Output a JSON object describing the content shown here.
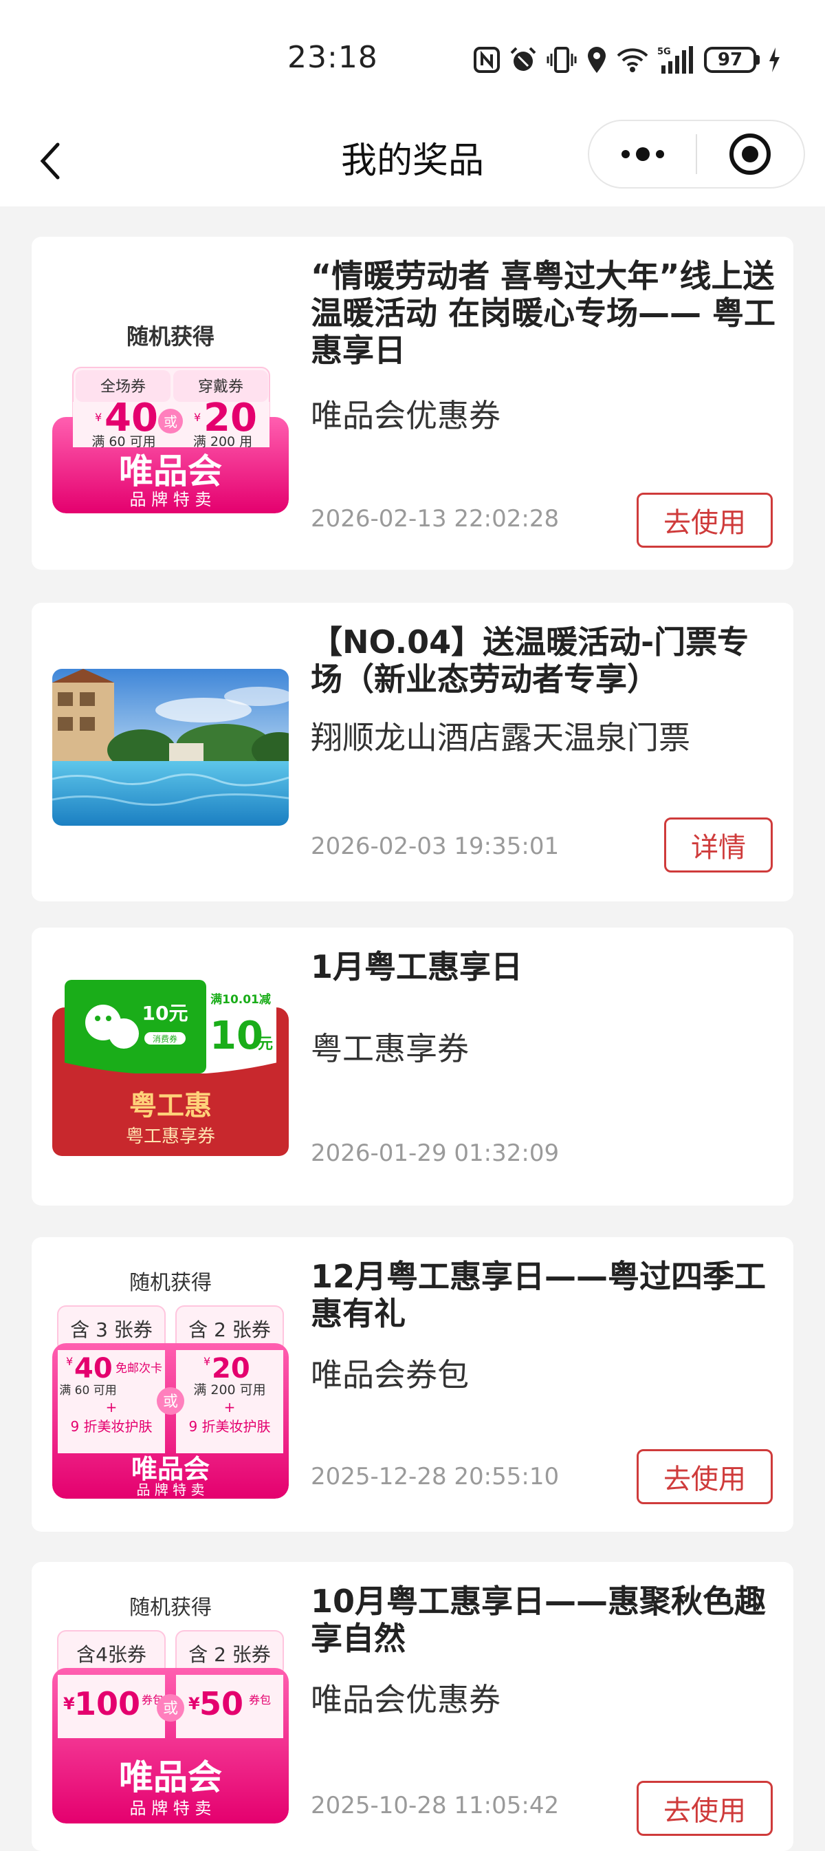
{
  "status_bar": {
    "time": "23:18",
    "battery": "97",
    "network": "5G",
    "icons": [
      "nfc-icon",
      "alarm-icon",
      "vibrate-icon",
      "location-icon",
      "wifi-icon",
      "signal-icon",
      "battery-icon",
      "charging-icon"
    ]
  },
  "nav": {
    "title": "我的奖品",
    "back_icon": "chevron-left-icon",
    "more_icon": "more-dots-icon",
    "close_icon": "target-circle-icon"
  },
  "colors": {
    "accent_red": "#cf3b3b",
    "vip_pink": "#f0268d",
    "wechat_green": "#1aad19",
    "bag_red": "#c8282d"
  },
  "prizes": [
    {
      "title": "“情暖劳动者 喜粤过大年”线上送温暖活动 在岗暖心专场—— 粤工惠享日",
      "subtitle": "唯品会优惠券",
      "time": "2026-02-13 22:02:28",
      "action": "去使用",
      "thumb": {
        "header": "随机获得",
        "tabs": [
          "全场券",
          "穿戴券"
        ],
        "amount_left": "40",
        "cond_left": "满 60 可用",
        "amount_right": "20",
        "cond_right": "满 200 用",
        "or": "或",
        "currency": "¥",
        "brand": "唯品会",
        "brand_sub": "品 牌 特 卖"
      }
    },
    {
      "title": "【NO.04】送温暖活动-门票专场（新业态劳动者专享）",
      "subtitle": "翔顺龙山酒店露天温泉门票",
      "time": "2026-02-03 19:35:01",
      "action": "详情"
    },
    {
      "title": "1月粤工惠享日",
      "subtitle": "粤工惠享券",
      "time": "2026-01-29 01:32:09",
      "thumb": {
        "left_amount": "10元",
        "left_tag": "消费券",
        "right_cond": "满10.01减",
        "right_amount": "10",
        "right_unit": "元",
        "brand": "粤工惠",
        "brand_sub": "粤工惠享券"
      }
    },
    {
      "title": "12月粤工惠享日——粤过四季工惠有礼",
      "subtitle": "唯品会券包",
      "time": "2025-12-28 20:55:10",
      "action": "去使用",
      "thumb": {
        "header": "随机获得",
        "tabs": [
          "含 3 张券",
          "含 2 张券"
        ],
        "amount_left": "40",
        "cond_left": "满 60 可用",
        "extra_left": "免邮次卡",
        "amount_right": "20",
        "cond_right": "满 200 可用",
        "discount_left": "9 折美妆护肤",
        "discount_right": "9 折美妆护肤",
        "or": "或",
        "currency": "¥",
        "plus": "+",
        "brand": "唯品会",
        "brand_sub": "品 牌 特 卖"
      }
    },
    {
      "title": "10月粤工惠享日——惠聚秋色趣享自然",
      "subtitle": "唯品会优惠券",
      "time": "2025-10-28 11:05:42",
      "action": "去使用",
      "thumb": {
        "header": "随机获得",
        "tabs": [
          "含4张券",
          "含 2 张券"
        ],
        "amount_left": "100",
        "amount_right": "50",
        "pack_word": "券包",
        "or": "或",
        "currency": "¥",
        "brand": "唯品会",
        "brand_sub": "品 牌 特 卖"
      }
    }
  ]
}
